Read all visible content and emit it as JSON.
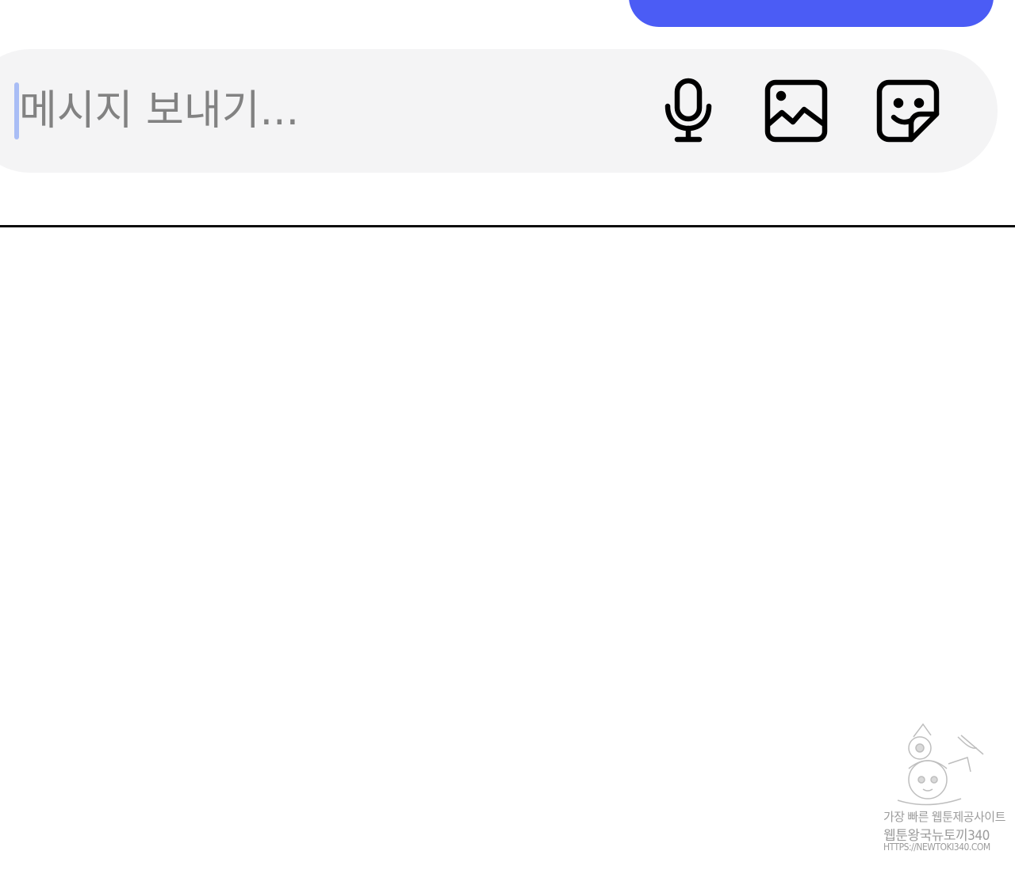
{
  "colors": {
    "sent_bubble": "#4b5cf5",
    "composer_background": "#f4f4f5",
    "cursor": "#a9bdf5",
    "icon": "#000000",
    "divider": "#0b0b0b"
  },
  "composer": {
    "placeholder": "메시지 보내기...",
    "value": "",
    "icons": [
      "microphone-icon",
      "image-icon",
      "sticker-icon"
    ]
  },
  "watermark": {
    "line1": "가장 빠른 웹툰제공사이트",
    "line2": "웹툰왕국뉴토끼340",
    "line3": "HTTPS://NEWTOKI340.COM"
  }
}
